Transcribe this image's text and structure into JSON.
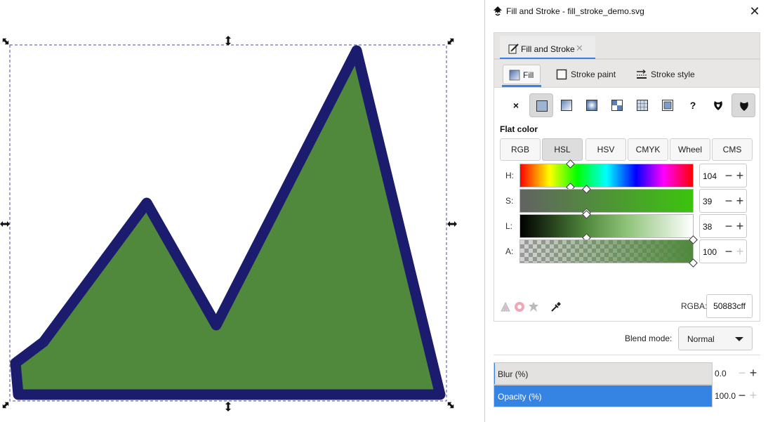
{
  "dialog": {
    "title": "Fill and Stroke - fill_stroke_demo.svg",
    "close_glyph": "✕",
    "notebook_tab": {
      "label": "Fill and Stroke",
      "close_glyph": "✕"
    },
    "subtabs": {
      "fill": "Fill",
      "stroke_paint": "Stroke paint",
      "stroke_style": "Stroke style"
    },
    "paint_modes": [
      {
        "name": "no-paint",
        "glyph": "×",
        "active": false
      },
      {
        "name": "flat-color",
        "glyph": "",
        "active": true
      },
      {
        "name": "linear-gradient",
        "glyph": "",
        "active": false
      },
      {
        "name": "radial-gradient",
        "glyph": "",
        "active": false
      },
      {
        "name": "pattern",
        "glyph": "",
        "active": false
      },
      {
        "name": "mesh",
        "glyph": "",
        "active": false
      },
      {
        "name": "swatch",
        "glyph": "",
        "active": false
      },
      {
        "name": "unset",
        "glyph": "?",
        "active": false
      },
      {
        "name": "fill-rule-evenodd",
        "glyph": "",
        "active": false
      },
      {
        "name": "fill-rule-nonzero",
        "glyph": "",
        "active": true
      }
    ],
    "flat_color_label": "Flat color",
    "color_spaces": [
      "RGB",
      "HSL",
      "HSV",
      "CMYK",
      "Wheel",
      "CMS"
    ],
    "active_color_space": "HSL",
    "sliders": [
      {
        "label": "H:",
        "value": "104"
      },
      {
        "label": "S:",
        "value": "39"
      },
      {
        "label": "L:",
        "value": "38"
      },
      {
        "label": "A:",
        "value": "100"
      }
    ],
    "rgba": {
      "label": "RGBA:",
      "value": "50883cff"
    },
    "blend": {
      "label": "Blend mode:",
      "value": "Normal"
    },
    "blur": {
      "label": "Blur (%)",
      "value": "0.0"
    },
    "opacity": {
      "label": "Opacity (%)",
      "value": "100.0"
    }
  },
  "shape": {
    "fill_color": "#50883c",
    "stroke_color": "#1c1c6e"
  },
  "colors": {
    "accent": "#3584e4"
  }
}
